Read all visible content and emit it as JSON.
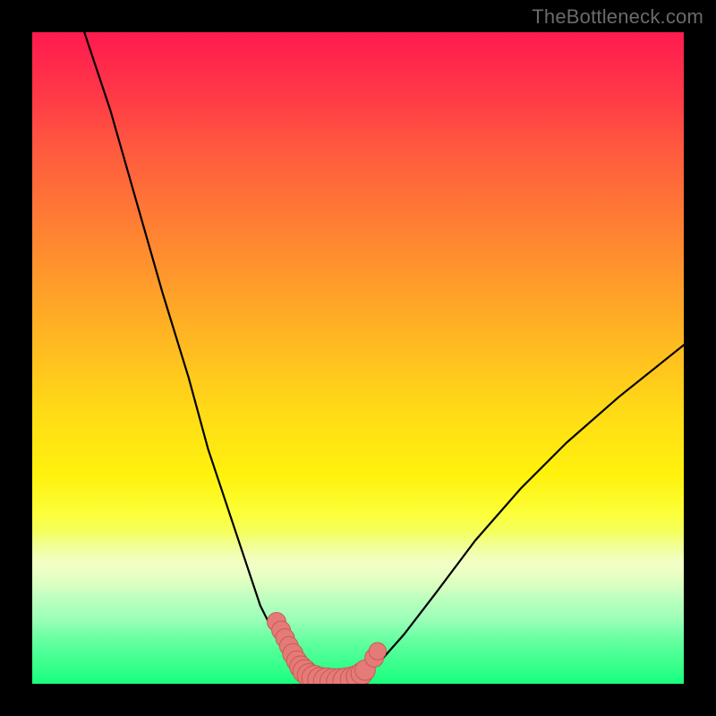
{
  "watermark": "TheBottleneck.com",
  "chart_data": {
    "type": "line",
    "title": "",
    "xlabel": "",
    "ylabel": "",
    "xlim": [
      0,
      100
    ],
    "ylim": [
      0,
      100
    ],
    "background_gradient": {
      "orientation": "vertical",
      "stops": [
        {
          "pos": 0,
          "color": "#ff1a4f"
        },
        {
          "pos": 50,
          "color": "#ffda17"
        },
        {
          "pos": 100,
          "color": "#18ff7e"
        }
      ]
    },
    "series": [
      {
        "name": "left-curve",
        "x": [
          8,
          12,
          16,
          20,
          24,
          27,
          30,
          33,
          35,
          37,
          39,
          40.5,
          42
        ],
        "y": [
          100,
          88,
          74,
          60,
          47,
          36,
          27,
          18,
          12,
          8,
          4.5,
          2.2,
          0.5
        ]
      },
      {
        "name": "floor",
        "x": [
          42,
          45,
          48,
          50
        ],
        "y": [
          0.5,
          0.0,
          0.0,
          0.5
        ]
      },
      {
        "name": "right-curve",
        "x": [
          50,
          53,
          57,
          62,
          68,
          75,
          82,
          90,
          100
        ],
        "y": [
          0.5,
          3,
          7.5,
          14,
          22,
          30,
          37,
          44,
          52
        ]
      }
    ],
    "markers": {
      "name": "salmon-dots",
      "color": "#e57b78",
      "points": [
        {
          "x": 37.5,
          "y": 9.5,
          "r": 1.2
        },
        {
          "x": 38.2,
          "y": 8.2,
          "r": 1.2
        },
        {
          "x": 38.8,
          "y": 7.0,
          "r": 1.2
        },
        {
          "x": 39.4,
          "y": 5.8,
          "r": 1.2
        },
        {
          "x": 40.0,
          "y": 4.6,
          "r": 1.3
        },
        {
          "x": 40.6,
          "y": 3.5,
          "r": 1.3
        },
        {
          "x": 41.2,
          "y": 2.6,
          "r": 1.4
        },
        {
          "x": 41.8,
          "y": 1.9,
          "r": 1.5
        },
        {
          "x": 42.5,
          "y": 1.3,
          "r": 1.5
        },
        {
          "x": 43.3,
          "y": 0.9,
          "r": 1.6
        },
        {
          "x": 44.2,
          "y": 0.6,
          "r": 1.6
        },
        {
          "x": 45.2,
          "y": 0.4,
          "r": 1.7
        },
        {
          "x": 46.2,
          "y": 0.3,
          "r": 1.7
        },
        {
          "x": 47.2,
          "y": 0.3,
          "r": 1.7
        },
        {
          "x": 48.2,
          "y": 0.4,
          "r": 1.7
        },
        {
          "x": 49.2,
          "y": 0.7,
          "r": 1.6
        },
        {
          "x": 50.0,
          "y": 1.1,
          "r": 1.5
        },
        {
          "x": 50.6,
          "y": 1.6,
          "r": 1.4
        },
        {
          "x": 51.1,
          "y": 2.1,
          "r": 1.3
        },
        {
          "x": 52.5,
          "y": 4.0,
          "r": 1.2
        },
        {
          "x": 53.0,
          "y": 5.0,
          "r": 1.1
        }
      ]
    }
  }
}
